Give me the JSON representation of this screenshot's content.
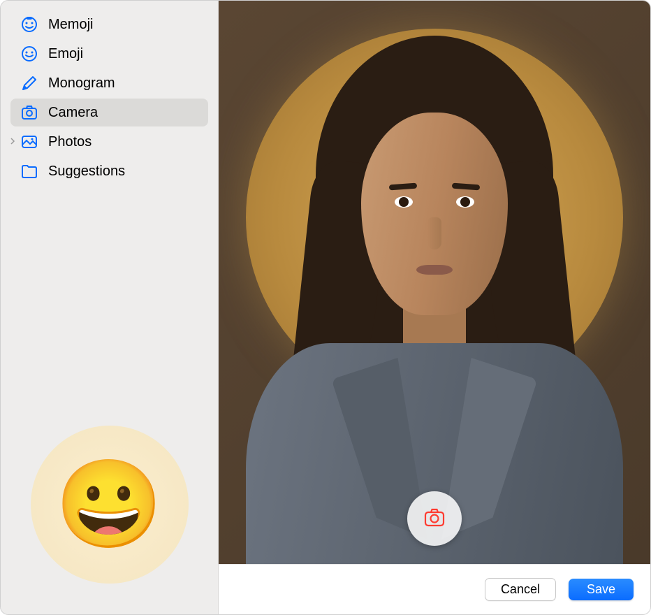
{
  "sidebar": {
    "items": [
      {
        "label": "Memoji",
        "icon": "memoji-face-icon",
        "selected": false
      },
      {
        "label": "Emoji",
        "icon": "emoji-smile-icon",
        "selected": false
      },
      {
        "label": "Monogram",
        "icon": "pencil-icon",
        "selected": false
      },
      {
        "label": "Camera",
        "icon": "camera-icon",
        "selected": true
      },
      {
        "label": "Photos",
        "icon": "photos-icon",
        "selected": false,
        "expandable": true
      },
      {
        "label": "Suggestions",
        "icon": "folder-icon",
        "selected": false
      }
    ]
  },
  "current_avatar": {
    "emoji": "😀"
  },
  "buttons": {
    "cancel": "Cancel",
    "save": "Save"
  },
  "colors": {
    "accent": "#0a6cff",
    "sidebar_icon": "#0a6cff"
  }
}
